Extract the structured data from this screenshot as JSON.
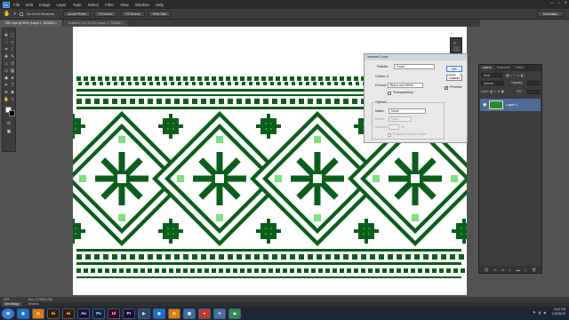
{
  "menubar": {
    "logo": "Ps",
    "items": [
      "File",
      "Edit",
      "Image",
      "Layer",
      "Type",
      "Select",
      "Filter",
      "View",
      "Window",
      "Help"
    ]
  },
  "options_bar": {
    "scroll_all_label": "Scroll All Windows",
    "buttons": [
      "Actual Pixels",
      "Fit Screen",
      "Fill Screen",
      "Print Size"
    ],
    "workspace": "Essentials"
  },
  "tabs": [
    {
      "label": "283 .eps @ 50% (Layer 1, RGB/8) ×",
      "active": true
    },
    {
      "label": "Untitled-1 @ 33.3% (Layer 1, RGB/8) ×",
      "active": false
    }
  ],
  "dialog": {
    "title": "Indexed Color",
    "palette_label": "Palette:",
    "palette_value": "Exact",
    "colors_label": "Colors: 5",
    "forced_label": "Forced:",
    "forced_value": "Black and White",
    "transparency_label": "Transparency",
    "options_label": "Options",
    "matte_label": "Matte:",
    "matte_value": "None",
    "dither_label": "Dither:",
    "dither_value": "None",
    "amount_label": "Amount:",
    "amount_unit": "%",
    "preserve_label": "Preserve Exact Colors",
    "ok_label": "OK",
    "cancel_label": "Cancel",
    "preview_label": "Preview"
  },
  "layers_panel": {
    "tabs": [
      "Layers",
      "Channels",
      "Paths"
    ],
    "kind_label": "Kind",
    "blend_value": "Normal",
    "opacity_label": "Opacity:",
    "lock_label": "Lock:",
    "fill_label": "Fill:",
    "layer_name": "Layer 1",
    "footer_icons": [
      "link-icon",
      "fx-icon",
      "mask-icon",
      "adjust-icon",
      "folder-icon",
      "new-layer-icon",
      "trash-icon"
    ]
  },
  "status": {
    "zoom": "50%",
    "doc": "Doc: 11.9M/11.9M"
  },
  "minibridge": [
    "Mini Bridge",
    "Timeline"
  ],
  "taskbar": {
    "apps": [
      {
        "label": "◉",
        "color": "#1d6fd8"
      },
      {
        "label": "◎",
        "color": "#e07b00"
      },
      {
        "label": "Ai",
        "color": "#3a1a00"
      },
      {
        "label": "Ai",
        "color": "#3a1a00"
      },
      {
        "label": "Ae",
        "color": "#1a0f3a"
      },
      {
        "label": "Ps",
        "color": "#0a2540"
      },
      {
        "label": "Id",
        "color": "#3a0a24"
      },
      {
        "label": "Pr",
        "color": "#1a0f3a"
      },
      {
        "label": "▶",
        "color": "#2a4a6a"
      },
      {
        "label": "◉",
        "color": "#1d6fd8"
      },
      {
        "label": "◎",
        "color": "#e07b00"
      },
      {
        "label": "▣",
        "color": "#3a6ea5"
      },
      {
        "label": "●",
        "color": "#c0392b"
      },
      {
        "label": "✦",
        "color": "#4a6fa5"
      },
      {
        "label": "◆",
        "color": "#2e8b57"
      }
    ],
    "time": "5:42 PM",
    "date": "1/22/2015"
  },
  "colors": {
    "dark_green": "#0b5e1c",
    "mid_green": "#2a9e2a",
    "light_green": "#7fe07f",
    "accent_blue": "#4c6b95"
  }
}
